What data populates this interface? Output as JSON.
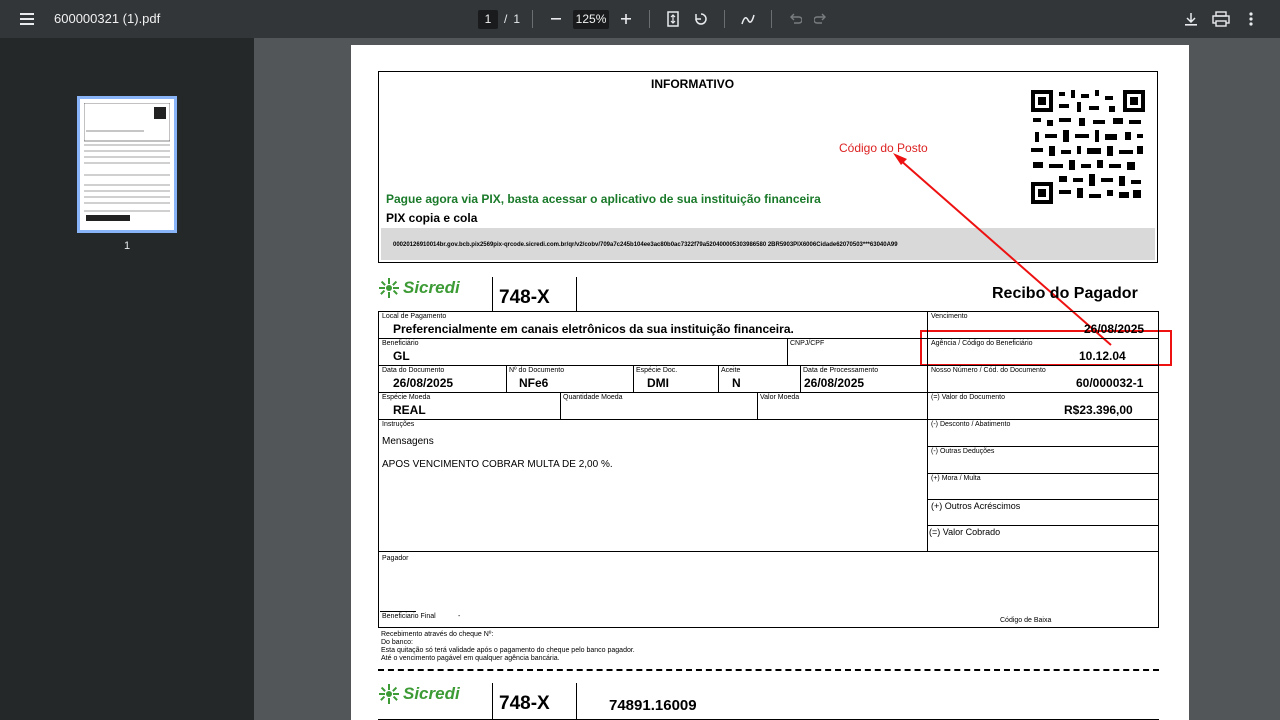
{
  "toolbar": {
    "title": "600000321 (1).pdf",
    "page_current": "1",
    "page_separator": "/",
    "page_total": "1",
    "zoom": "125%"
  },
  "sidebar": {
    "thumb_label": "1"
  },
  "document": {
    "informativo": "INFORMATIVO",
    "pix_cta": "Pague agora via PIX, basta acessar o aplicativo de sua instituição financeira",
    "pix_copia": "PIX copia e cola",
    "pix_code": "00020126910014br.gov.bcb.pix2569pix-qrcode.sicredi.com.br/qr/v2/cobv/709a7c245b104ee3ac80b0ac7322f79a520400005303986580 2BR5903PIX6006Cidade62070503***63040A99",
    "annotation": "Código do Posto",
    "brand": "Sicredi",
    "bank_code": "748-X",
    "recibo": "Recibo do Pagador",
    "local_pagamento_label": "Local de Pagamento",
    "local_pagamento": "Preferencialmente em canais eletrônicos da sua instituição financeira.",
    "vencimento_label": "Vencimento",
    "vencimento": "26/08/2025",
    "beneficiario_label": "Beneficiário",
    "beneficiario": "GL",
    "cnpj_label": "CNPJ/CPF",
    "agencia_label": "Agência / Código do Beneficiário",
    "agencia": "10.12.04",
    "data_doc_label": "Data do Documento",
    "data_doc": "26/08/2025",
    "num_doc_label": "Nº do Documento",
    "num_doc": "NFe6",
    "especie_doc_label": "Espécie Doc.",
    "especie_doc": "DMI",
    "aceite_label": "Aceite",
    "aceite": "N",
    "data_proc_label": "Data de Processamento",
    "data_proc": "26/08/2025",
    "nosso_numero_label": "Nosso Número / Cód. do Documento",
    "nosso_numero": "60/000032-1",
    "especie_moeda_label": "Espécie Moeda",
    "especie_moeda": "REAL",
    "quantidade_label": "Quantidade Moeda",
    "valor_moeda_label": "Valor Moeda",
    "valor_doc_label": "(=) Valor do Documento",
    "valor_doc": "R$23.396,00",
    "instrucoes_label": "Instruções",
    "mensagens": "Mensagens",
    "instrucao_texto": "APOS VENCIMENTO COBRAR MULTA DE 2,00 %.",
    "desconto_label": "(-) Desconto / Abatimento",
    "outras_deducoes_label": "(-) Outras Deduções",
    "mora_label": "(+) Mora / Multa",
    "outros_acrescimos_label": "(+) Outros Acréscimos",
    "valor_cobrado_label": "(=) Valor Cobrado",
    "pagador_label": "Pagador",
    "beneficiario_final_label": "Beneficiario Final",
    "beneficiario_final": "-",
    "codigo_baixa_label": "Código de Baixa",
    "rodape_1": "Recebimento através do cheque Nº:",
    "rodape_2": "Do banco:",
    "rodape_3": "Esta quitação só terá validade após o pagamento do cheque pelo banco pagador.",
    "rodape_4": "Até o vencimento pagável em qualquer agência bancária.",
    "linha_digitavel": "74891.16009"
  }
}
